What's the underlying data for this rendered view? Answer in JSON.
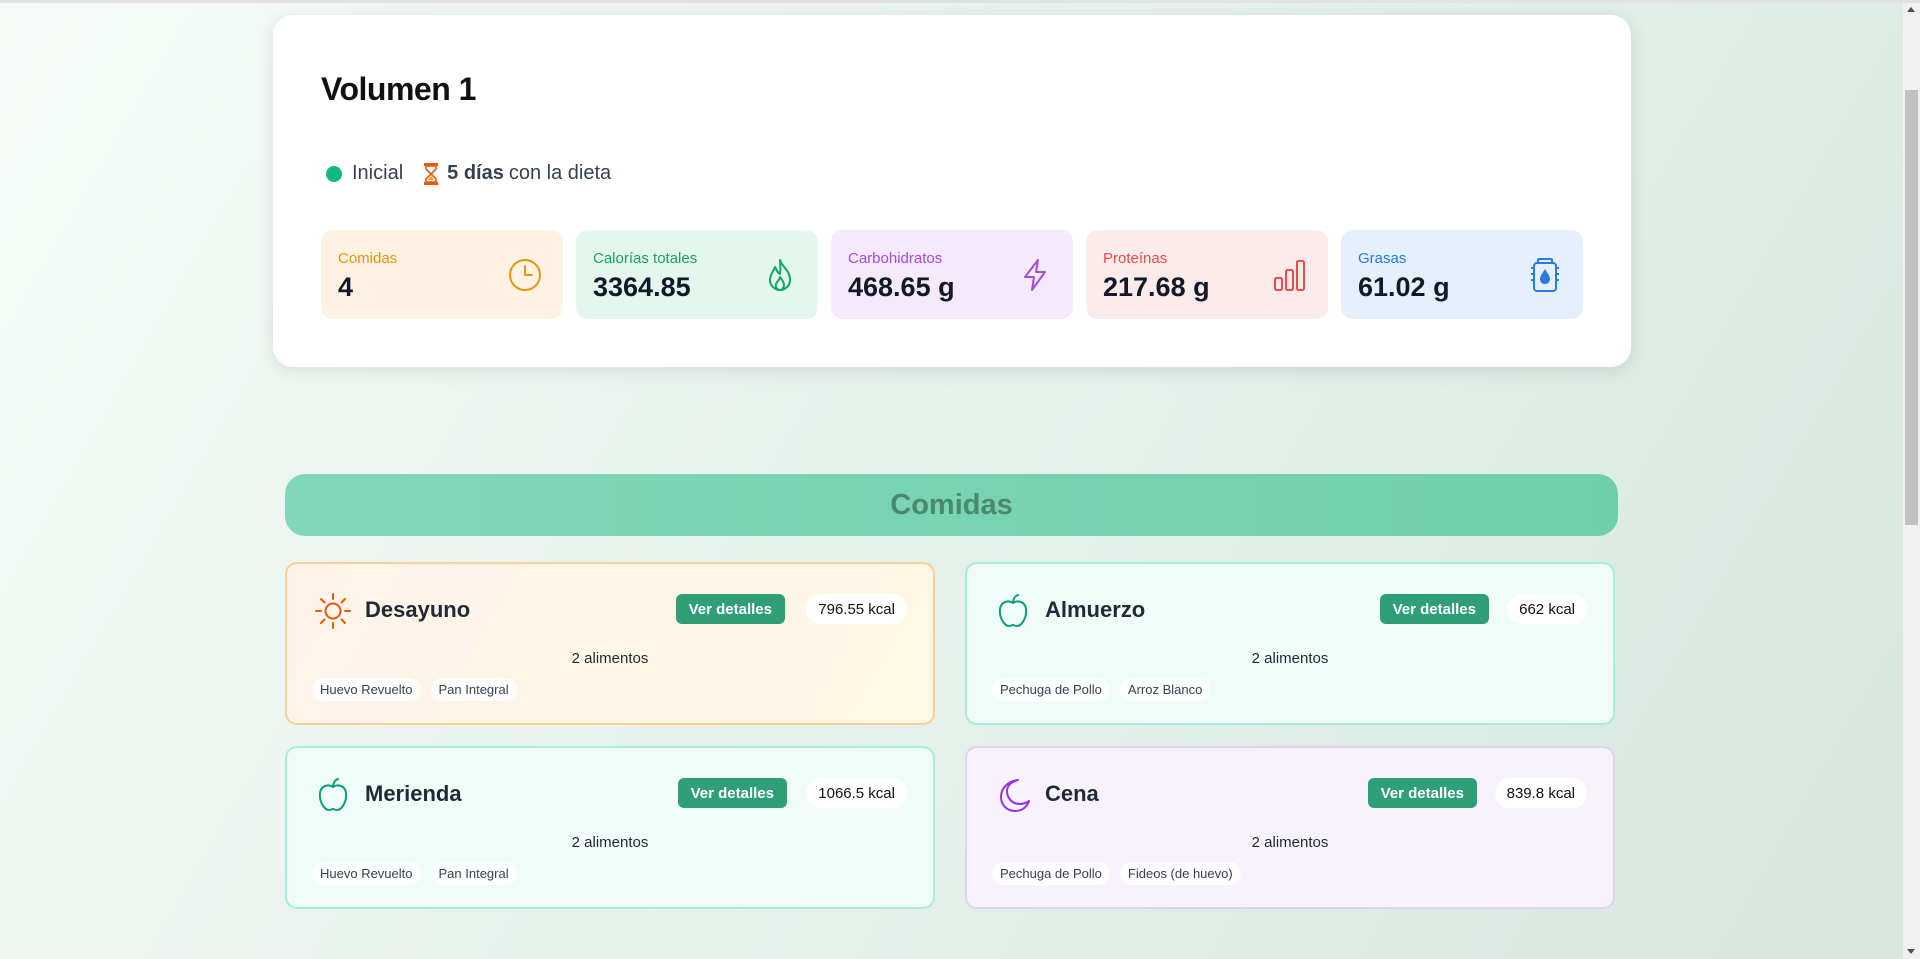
{
  "summary": {
    "title": "Volumen 1",
    "status_label": "Inicial",
    "days_bold": "5 días",
    "days_rest": "con la dieta",
    "stats": [
      {
        "label": "Comidas",
        "value": "4",
        "icon": "clock-icon"
      },
      {
        "label": "Calorías totales",
        "value": "3364.85",
        "icon": "flame-icon"
      },
      {
        "label": "Carbohidratos",
        "value": "468.65 g",
        "icon": "lightning-icon"
      },
      {
        "label": "Proteínas",
        "value": "217.68 g",
        "icon": "bar-chart-icon"
      },
      {
        "label": "Grasas",
        "value": "61.02 g",
        "icon": "oil-jar-icon"
      }
    ]
  },
  "meals_section": {
    "title": "Comidas",
    "details_label": "Ver detalles",
    "meals": [
      {
        "name": "Desayuno",
        "icon": "sun-icon",
        "kcal": "796.55 kcal",
        "count": "2 alimentos",
        "foods": [
          "Huevo Revuelto",
          "Pan Integral"
        ]
      },
      {
        "name": "Almuerzo",
        "icon": "apple-icon",
        "kcal": "662 kcal",
        "count": "2 alimentos",
        "foods": [
          "Pechuga de Pollo",
          "Arroz Blanco"
        ]
      },
      {
        "name": "Merienda",
        "icon": "apple-icon",
        "kcal": "1066.5 kcal",
        "count": "2 alimentos",
        "foods": [
          "Huevo Revuelto",
          "Pan Integral"
        ]
      },
      {
        "name": "Cena",
        "icon": "moon-icon",
        "kcal": "839.8 kcal",
        "count": "2 alimentos",
        "foods": [
          "Pechuga de Pollo",
          "Fideos (de huevo)"
        ]
      }
    ]
  },
  "colors": {
    "accent": "#2f9f78",
    "status_dot": "#10b981",
    "banner": "#79d5b4"
  }
}
